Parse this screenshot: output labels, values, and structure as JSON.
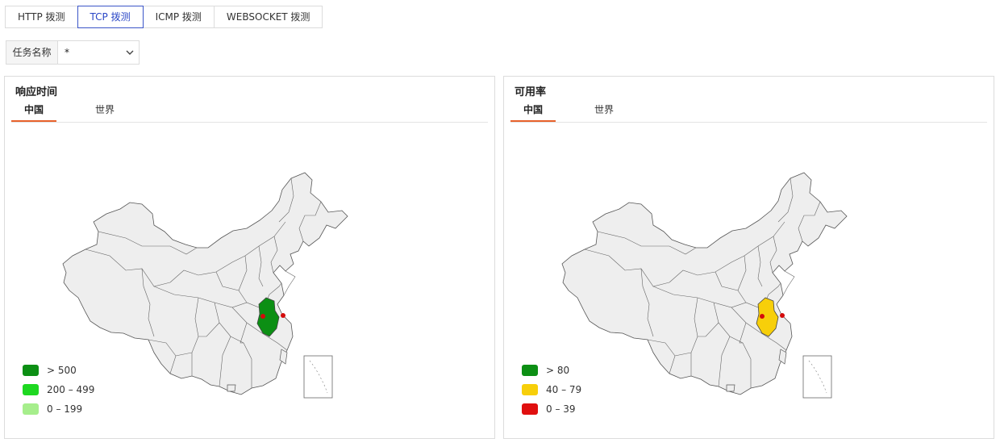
{
  "top_tabs": [
    {
      "label": "HTTP 拨测",
      "active": false
    },
    {
      "label": "TCP 拨测",
      "active": true
    },
    {
      "label": "ICMP 拨测",
      "active": false
    },
    {
      "label": "WEBSOCKET 拨测",
      "active": false
    }
  ],
  "filter": {
    "label": "任务名称",
    "value": "*"
  },
  "panels": [
    {
      "title": "响应时间",
      "subtabs": [
        "中国",
        "世界"
      ],
      "active_subtab": 0,
      "highlight_color": "#0c8f14",
      "legend": [
        {
          "label": "> 500",
          "color": "#0c8f14"
        },
        {
          "label": "200 – 499",
          "color": "#1ed821"
        },
        {
          "label": "0 – 199",
          "color": "#a6ee8c"
        }
      ]
    },
    {
      "title": "可用率",
      "subtabs": [
        "中国",
        "世界"
      ],
      "active_subtab": 0,
      "highlight_color": "#f7cf0a",
      "legend": [
        {
          "label": "> 80",
          "color": "#0c8f14"
        },
        {
          "label": "40 – 79",
          "color": "#f7cf0a"
        },
        {
          "label": "0 – 39",
          "color": "#e00f0f"
        }
      ]
    }
  ],
  "colors": {
    "accent": "#e8622c",
    "active_tab": "#2a46c6",
    "marker": "#d40b0b",
    "map_fill": "#eeeeee"
  }
}
